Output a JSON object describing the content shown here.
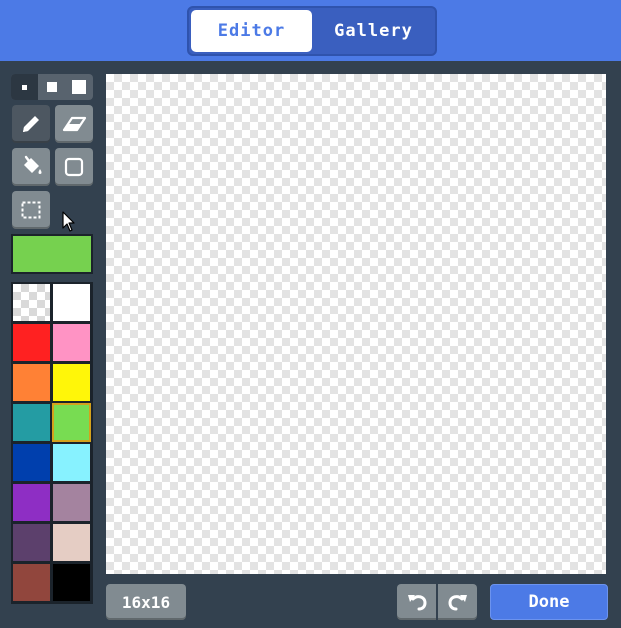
{
  "tabs": {
    "editor": "Editor",
    "gallery": "Gallery"
  },
  "tools": {
    "brush_sizes": [
      "small",
      "medium",
      "large"
    ],
    "items": [
      "pencil-icon",
      "eraser-icon",
      "fill-bucket-icon",
      "rectangle-icon",
      "marquee-select-icon"
    ]
  },
  "current_color": "#76d14f",
  "palette": [
    "transparent",
    "#ffffff",
    "#ff2121",
    "#ff93c4",
    "#ff8135",
    "#fff609",
    "#249ca3",
    "#78dc52",
    "#003fad",
    "#87f2ff",
    "#8e2ec4",
    "#a4839f",
    "#5c406c",
    "#e5cdc4",
    "#91463d",
    "#000000"
  ],
  "selected_swatch": 7,
  "footer": {
    "size": "16x16",
    "done": "Done"
  }
}
